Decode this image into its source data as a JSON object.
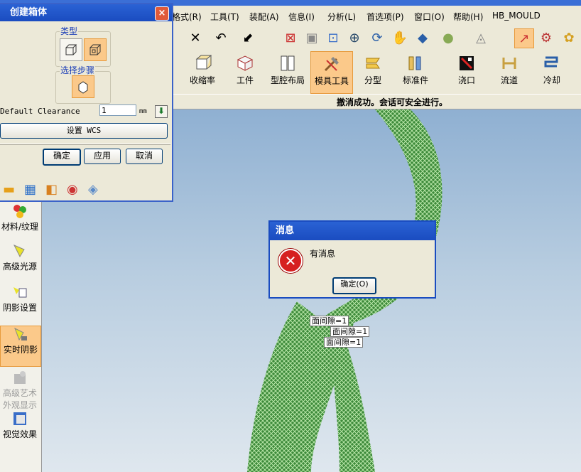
{
  "menu": {
    "items": [
      "格式(R)",
      "工具(T)",
      "装配(A)",
      "信息(I)",
      "分析(L)",
      "首选项(P)",
      "窗口(O)",
      "帮助(H)",
      "HB_MOULD"
    ]
  },
  "toolbar2": {
    "buttons": [
      "收缩率",
      "工件",
      "型腔布局",
      "模具工具",
      "分型",
      "标准件",
      "浇口",
      "流道",
      "冷却"
    ],
    "active": "模具工具"
  },
  "status": {
    "message": "撤消成功。会话可安全进行。"
  },
  "dialog": {
    "title": "创建箱体",
    "type_label": "类型",
    "step_label": "选择步骤",
    "clearance_label": "Default Clearance",
    "clearance_value": "1",
    "unit": "mm",
    "wcs_button": "设置 WCS",
    "ok": "确定",
    "apply": "应用",
    "cancel": "取消",
    "close": "×"
  },
  "leftpanel": {
    "items": [
      "材料/纹理",
      "高级光源",
      "阴影设置",
      "实时阴影",
      "高级艺术外观显示",
      "视觉效果"
    ],
    "active": "实时阴影",
    "disabled": "高级艺术外观显示"
  },
  "msgbox": {
    "title": "消息",
    "text": "有消息",
    "ok": "确定(O)"
  },
  "annotations": [
    "面间隙=1",
    "面间隙=1",
    "面间隙=1"
  ]
}
